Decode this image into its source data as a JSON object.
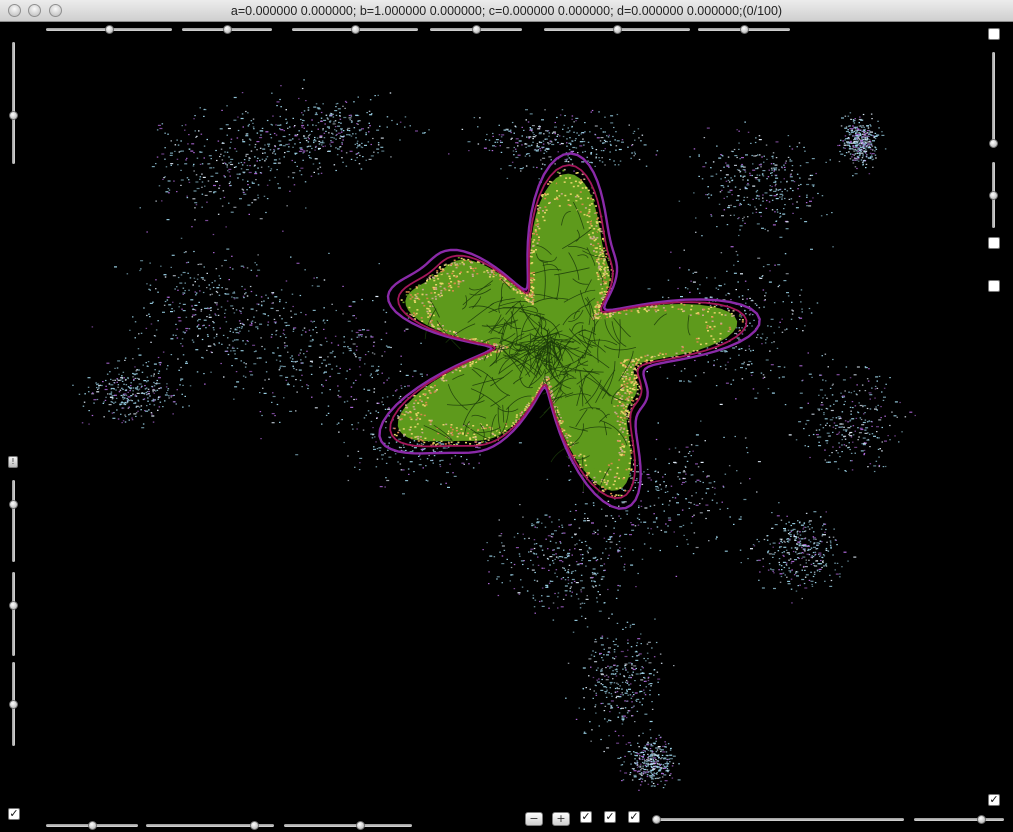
{
  "window": {
    "title": "a=0.000000 0.000000; b=1.000000 0.000000; c=0.000000 0.000000; d=0.000000 0.000000;(0/100)"
  },
  "controls": {
    "minus_label": "−",
    "plus_label": "+",
    "check_mark": "✓",
    "indicator_label": "!",
    "top_sliders": [
      0.5,
      0.5,
      0.5,
      0.5,
      0.5,
      0.5
    ],
    "left_sliders": [
      0.6,
      0.3,
      0.4,
      0.5
    ],
    "right_sliders": [
      0.95,
      0.5
    ],
    "bottom_sliders": [
      0.5,
      0.85,
      0.6,
      0.0,
      0.75
    ],
    "checkboxes": {
      "top_right_1": false,
      "right_2": false,
      "right_3": false,
      "bottom_left": true,
      "bottom_1": true,
      "bottom_2": true,
      "bottom_3": true,
      "bottom_right": true
    }
  },
  "plot": {
    "background": "#000000",
    "colors": {
      "cloud_cyan": "#9fd8ee",
      "cloud_violet": "#b46be0",
      "cloud_white": "#e6f2ff",
      "core_green": "#5e9a1c",
      "core_dark": "#1b3a0a",
      "rim_yellow": "#e8d66a",
      "rim_orange": "#d78a4c",
      "outline_purple": "#8a2aa8",
      "outline_magenta": "#a3175a"
    }
  }
}
